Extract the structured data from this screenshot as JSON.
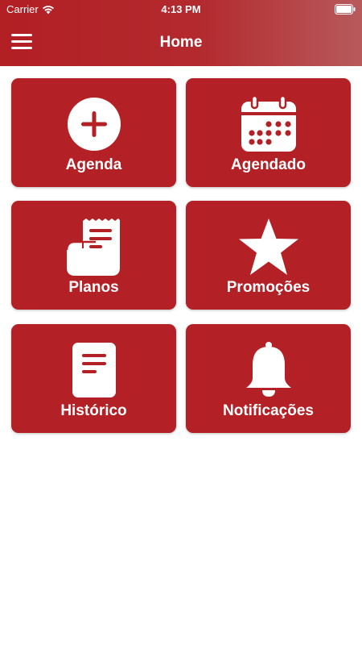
{
  "status_bar": {
    "carrier": "Carrier",
    "time": "4:13 PM"
  },
  "header": {
    "title": "Home"
  },
  "tiles": [
    {
      "label": "Agenda",
      "icon": "plus-circle-icon"
    },
    {
      "label": "Agendado",
      "icon": "calendar-icon"
    },
    {
      "label": "Planos",
      "icon": "receipt-icon"
    },
    {
      "label": "Promoções",
      "icon": "star-icon"
    },
    {
      "label": "Histórico",
      "icon": "document-icon"
    },
    {
      "label": "Notificações",
      "icon": "bell-icon"
    }
  ],
  "colors": {
    "accent": "#b32025",
    "header_start": "#b21f24",
    "header_end": "#b75a5c"
  }
}
